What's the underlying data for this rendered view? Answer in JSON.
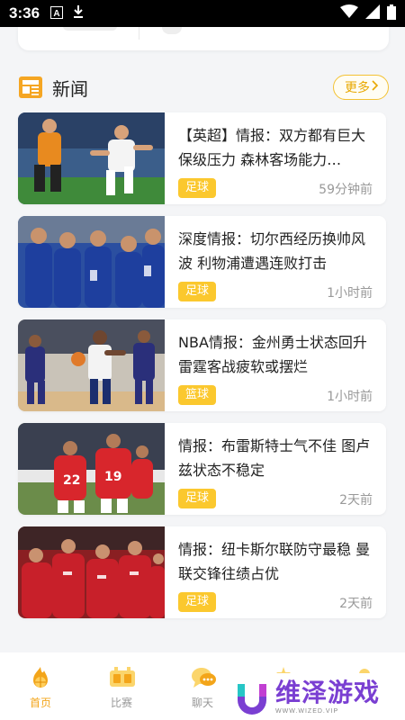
{
  "status_bar": {
    "time": "3:36"
  },
  "section": {
    "title": "新闻",
    "more_label": "更多"
  },
  "news": [
    {
      "headline": "【英超】情报：双方都有巨大保级压力 森林客场能力…",
      "tag": "足球",
      "time": "59分钟前",
      "thumb": "football-players-white-orange"
    },
    {
      "headline": "深度情报：切尔西经历换帅风波 利物浦遭遇连败打击",
      "tag": "足球",
      "time": "1小时前",
      "thumb": "football-team-blue-celebration"
    },
    {
      "headline": "NBA情报：金州勇士状态回升 雷霆客战疲软或摆烂",
      "tag": "篮球",
      "time": "1小时前",
      "thumb": "basketball-players"
    },
    {
      "headline": "情报：布雷斯特士气不佳 图卢兹状态不稳定",
      "tag": "足球",
      "time": "2天前",
      "thumb": "football-team-red-celebration"
    },
    {
      "headline": "情报：纽卡斯尔联防守最稳 曼联交锋往绩占优",
      "tag": "足球",
      "time": "2天前",
      "thumb": "football-team-red-group"
    }
  ],
  "tabbar": [
    {
      "label": "首页",
      "icon": "basketball-fire-icon",
      "active": true
    },
    {
      "label": "比赛",
      "icon": "scoreboard-icon",
      "active": false
    },
    {
      "label": "聊天",
      "icon": "chat-bubbles-icon",
      "active": false
    },
    {
      "label": "",
      "icon": "stars-icon",
      "active": false
    },
    {
      "label": "",
      "icon": "profile-icon",
      "active": false
    }
  ],
  "watermark": {
    "text": "维泽游戏",
    "url": "WWW.WIZED.VIP"
  },
  "colors": {
    "accent": "#fbc82e",
    "tab_active": "#f3a51a",
    "watermark": "#7a3fd2"
  }
}
